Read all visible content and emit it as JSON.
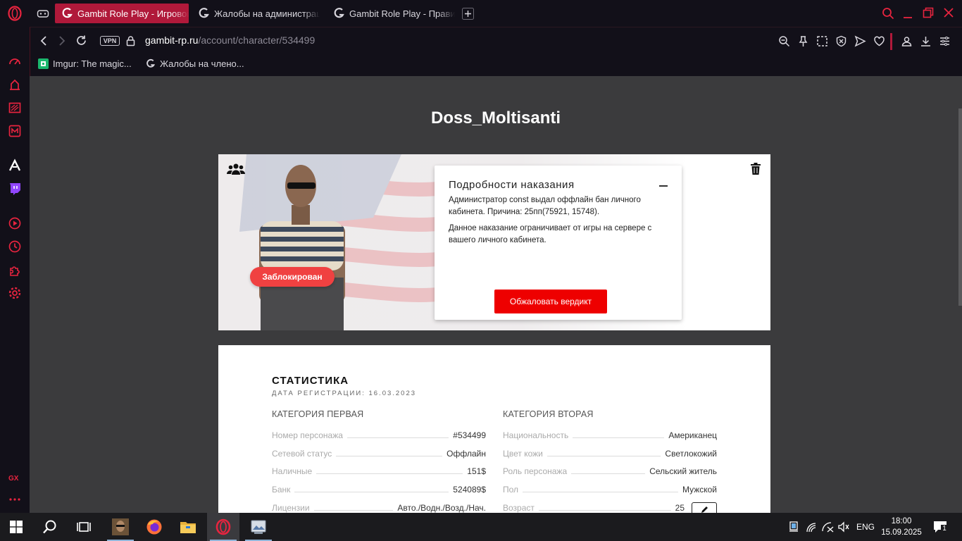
{
  "browser": {
    "tabs": [
      {
        "label": "Gambit Role Play - Игровой",
        "active": true
      },
      {
        "label": "Жалобы на администрацию",
        "active": false
      },
      {
        "label": "Gambit Role Play - Правила",
        "active": false
      }
    ],
    "address": {
      "vpn_label": "VPN",
      "domain": "gambit-rp.ru",
      "path": "/account/character/534499"
    },
    "bookmarks": [
      {
        "label": "Imgur: The magic...",
        "icon": "imgur-icon"
      },
      {
        "label": "Жалобы на члено...",
        "icon": "gambit-icon"
      }
    ],
    "sidebar_badge": "GX",
    "accent": "#b0193a"
  },
  "character": {
    "name": "Doss_Moltisanti",
    "status_badge": "Заблокирован"
  },
  "punishment": {
    "title": "Подробности наказания",
    "text1": "Администратор const выдал оффлайн бан личного кабинета. Причина: 25пп(75921, 15748).",
    "text2": "Данное наказание ограничивает от игры на сервере с вашего личного кабинета.",
    "appeal_label": "Обжаловать вердикт"
  },
  "stats": {
    "title": "СТАТИСТИКА",
    "reg_date": "ДАТА РЕГИСТРАЦИИ: 16.03.2023",
    "cat1": {
      "title": "КАТЕГОРИЯ ПЕРВАЯ",
      "rows": [
        {
          "label": "Номер персонажа",
          "value": "#534499"
        },
        {
          "label": "Сетевой статус",
          "value": "Оффлайн"
        },
        {
          "label": "Наличные",
          "value": "151$"
        },
        {
          "label": "Банк",
          "value": "524089$"
        },
        {
          "label": "Лицензии",
          "value": "Авто./Водн./Возд./Нач."
        }
      ]
    },
    "cat2": {
      "title": "КАТЕГОРИЯ ВТОРАЯ",
      "rows": [
        {
          "label": "Национальность",
          "value": "Американец"
        },
        {
          "label": "Цвет кожи",
          "value": "Светлокожий"
        },
        {
          "label": "Роль персонажа",
          "value": "Сельский житель"
        },
        {
          "label": "Пол",
          "value": "Мужской"
        },
        {
          "label": "Возраст",
          "value": "25"
        }
      ]
    }
  },
  "taskbar": {
    "lang": "ENG",
    "time": "18:00",
    "date": "15.09.2025",
    "notifications": "1"
  }
}
